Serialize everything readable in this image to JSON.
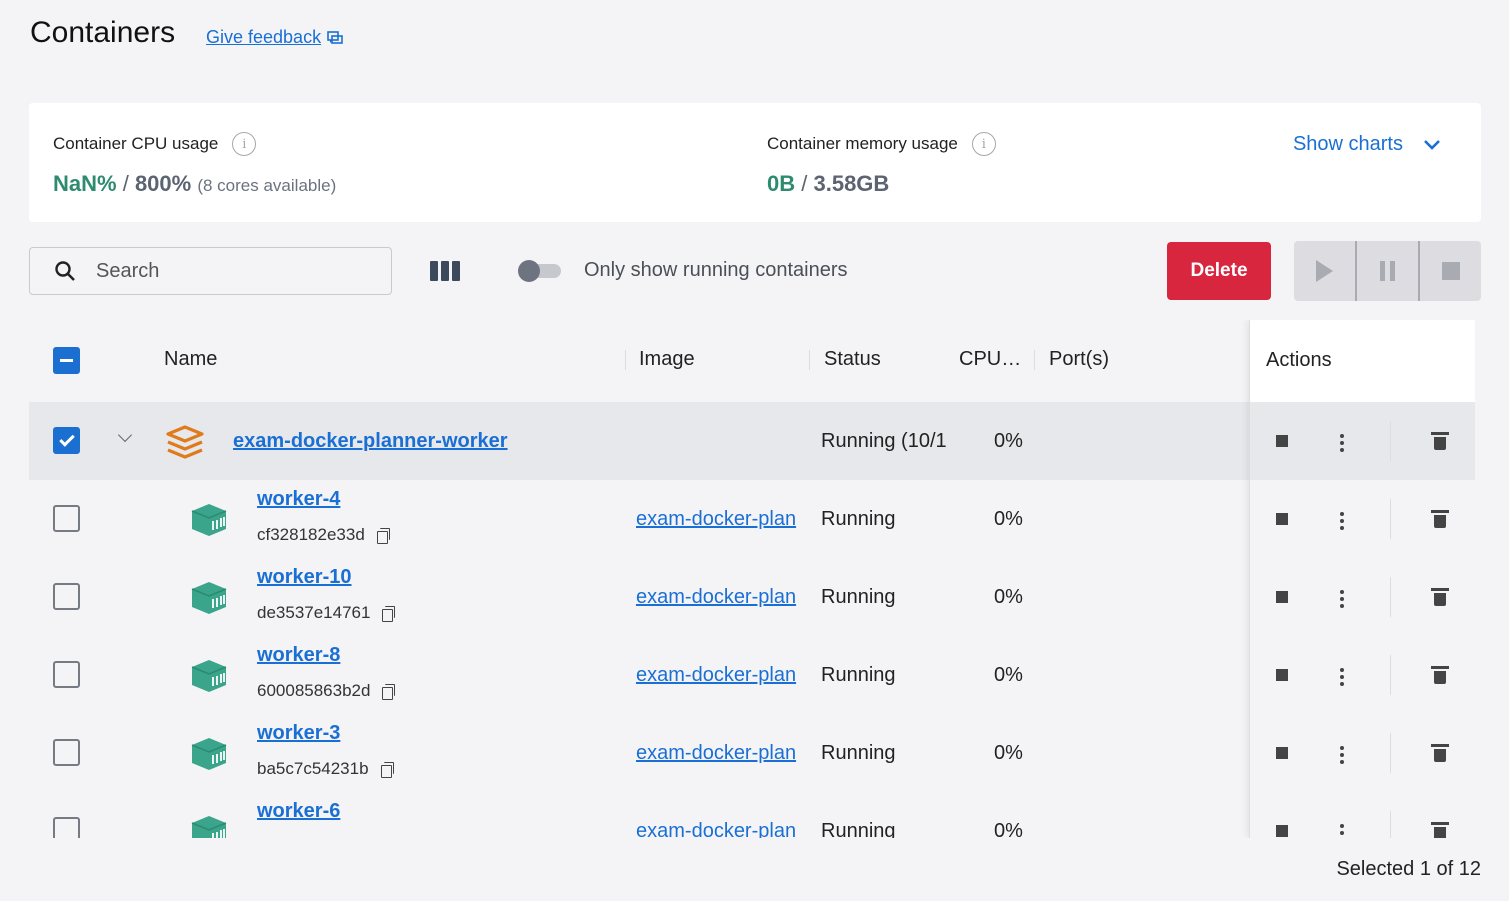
{
  "header": {
    "title": "Containers",
    "feedback_label": "Give feedback"
  },
  "stats": {
    "cpu_label": "Container CPU usage",
    "cpu_used": "NaN%",
    "cpu_total": "800%",
    "cpu_note": "(8 cores available)",
    "mem_label": "Container memory usage",
    "mem_used": "0B",
    "mem_total": "3.58GB",
    "show_charts_label": "Show charts"
  },
  "toolbar": {
    "search_placeholder": "Search",
    "toggle_label": "Only show running containers",
    "toggle_on": false,
    "delete_label": "Delete"
  },
  "table": {
    "columns": [
      "Name",
      "Image",
      "Status",
      "CPU…",
      "Port(s)",
      "Actions"
    ],
    "group": {
      "name": "exam-docker-planner-worker",
      "status": "Running (10/1",
      "cpu": "0%",
      "checked": true
    },
    "rows": [
      {
        "name": "worker-4",
        "id": "cf328182e33d",
        "image": "exam-docker-plan",
        "status": "Running",
        "cpu": "0%"
      },
      {
        "name": "worker-10",
        "id": "de3537e14761",
        "image": "exam-docker-plan",
        "status": "Running",
        "cpu": "0%"
      },
      {
        "name": "worker-8",
        "id": "600085863b2d",
        "image": "exam-docker-plan",
        "status": "Running",
        "cpu": "0%"
      },
      {
        "name": "worker-3",
        "id": "ba5c7c54231b",
        "image": "exam-docker-plan",
        "status": "Running",
        "cpu": "0%"
      },
      {
        "name": "worker-6",
        "id": "",
        "image": "exam-docker-plan",
        "status": "Running",
        "cpu": "0%"
      }
    ]
  },
  "footer": {
    "selection": "Selected 1 of 12"
  },
  "colors": {
    "accent": "#1a6fd4",
    "danger": "#d7263d",
    "stat_highlight": "#2e8b6e",
    "container_icon": "#3aa58b",
    "stack_icon": "#e07b1c"
  }
}
